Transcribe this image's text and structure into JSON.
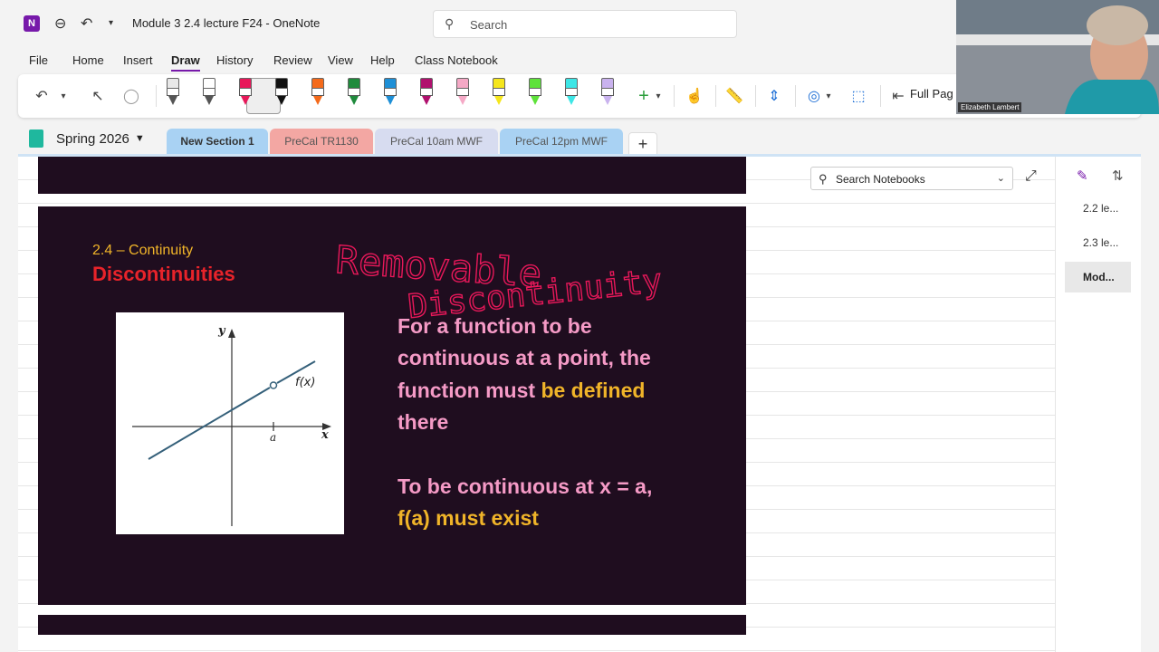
{
  "title_bar": {
    "app_logo": "N",
    "doc_title": "Module 3 2.4 lecture F24  -  OneNote",
    "search_placeholder": "Search"
  },
  "menu": [
    "File",
    "Home",
    "Insert",
    "Draw",
    "History",
    "Review",
    "View",
    "Help",
    "Class Notebook"
  ],
  "menu_active": "Draw",
  "ribbon": {
    "pen_colors": [
      "#e8e8e8",
      "#ffffff",
      "#e8185a",
      "#111111",
      "#f46a1b",
      "#1f8a3c",
      "#1e8fd6",
      "#b0106e",
      "#f5a9c6",
      "#f5e61c",
      "#5ee23a",
      "#3ee6e6",
      "#c9b2ee"
    ],
    "full_page_label": "Full Pag"
  },
  "notebook": {
    "name": "Spring 2026"
  },
  "tabs": [
    {
      "label": "New Section 1",
      "color": "#a9d2f3",
      "active": true
    },
    {
      "label": "PreCal TR1130",
      "color": "#f3a7a3",
      "active": false
    },
    {
      "label": "PreCal 10am MWF",
      "color": "#d7dcf0",
      "active": false
    },
    {
      "label": "PreCal 12pm MWF",
      "color": "#a9d2f3",
      "active": false
    }
  ],
  "add_tab": "+",
  "slide": {
    "subtitle": "2.4 – Continuity",
    "title": "Discontinuities",
    "body_line1": "For a function to be",
    "body_line2": "continuous at a point, the",
    "body_line3_pink": "function must ",
    "body_line3_yellow": "be defined",
    "body_line4": "there",
    "body_line5": "To be continuous at x = a,",
    "body_line6": "f(a) must exist",
    "graph": {
      "y_label": "y",
      "x_label": "x",
      "a_label": "a",
      "f_label": "f(x)"
    },
    "handwriting_line1": "Removable",
    "handwriting_line2": "Discontinuity"
  },
  "right_panel": {
    "search_placeholder": "Search Notebooks",
    "pages": [
      {
        "label": "2.2 le...",
        "active": false
      },
      {
        "label": "2.3 le...",
        "active": false
      },
      {
        "label": "Mod...",
        "active": true
      }
    ]
  },
  "webcam": {
    "name": "Elizabeth Lambert"
  }
}
